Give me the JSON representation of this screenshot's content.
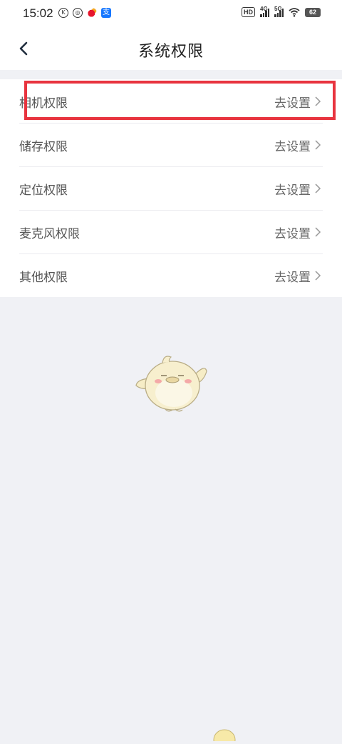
{
  "status_bar": {
    "time": "15:02",
    "icons": [
      "k-app-icon",
      "scan-app-icon",
      "weibo-icon",
      "alipay-icon"
    ],
    "hd_label": "HD",
    "network_1": "4G",
    "network_2": "5G",
    "battery": "62"
  },
  "header": {
    "title": "系统权限",
    "back_icon": "chevron-left-icon"
  },
  "permissions": [
    {
      "label": "相机权限",
      "action": "去设置"
    },
    {
      "label": "储存权限",
      "action": "去设置"
    },
    {
      "label": "定位权限",
      "action": "去设置"
    },
    {
      "label": "麦克风权限",
      "action": "去设置"
    },
    {
      "label": "其他权限",
      "action": "去设置"
    }
  ],
  "highlight_color": "#e8343f",
  "background_color": "#f0f1f5",
  "illustration": "chick-mascot-illustration"
}
